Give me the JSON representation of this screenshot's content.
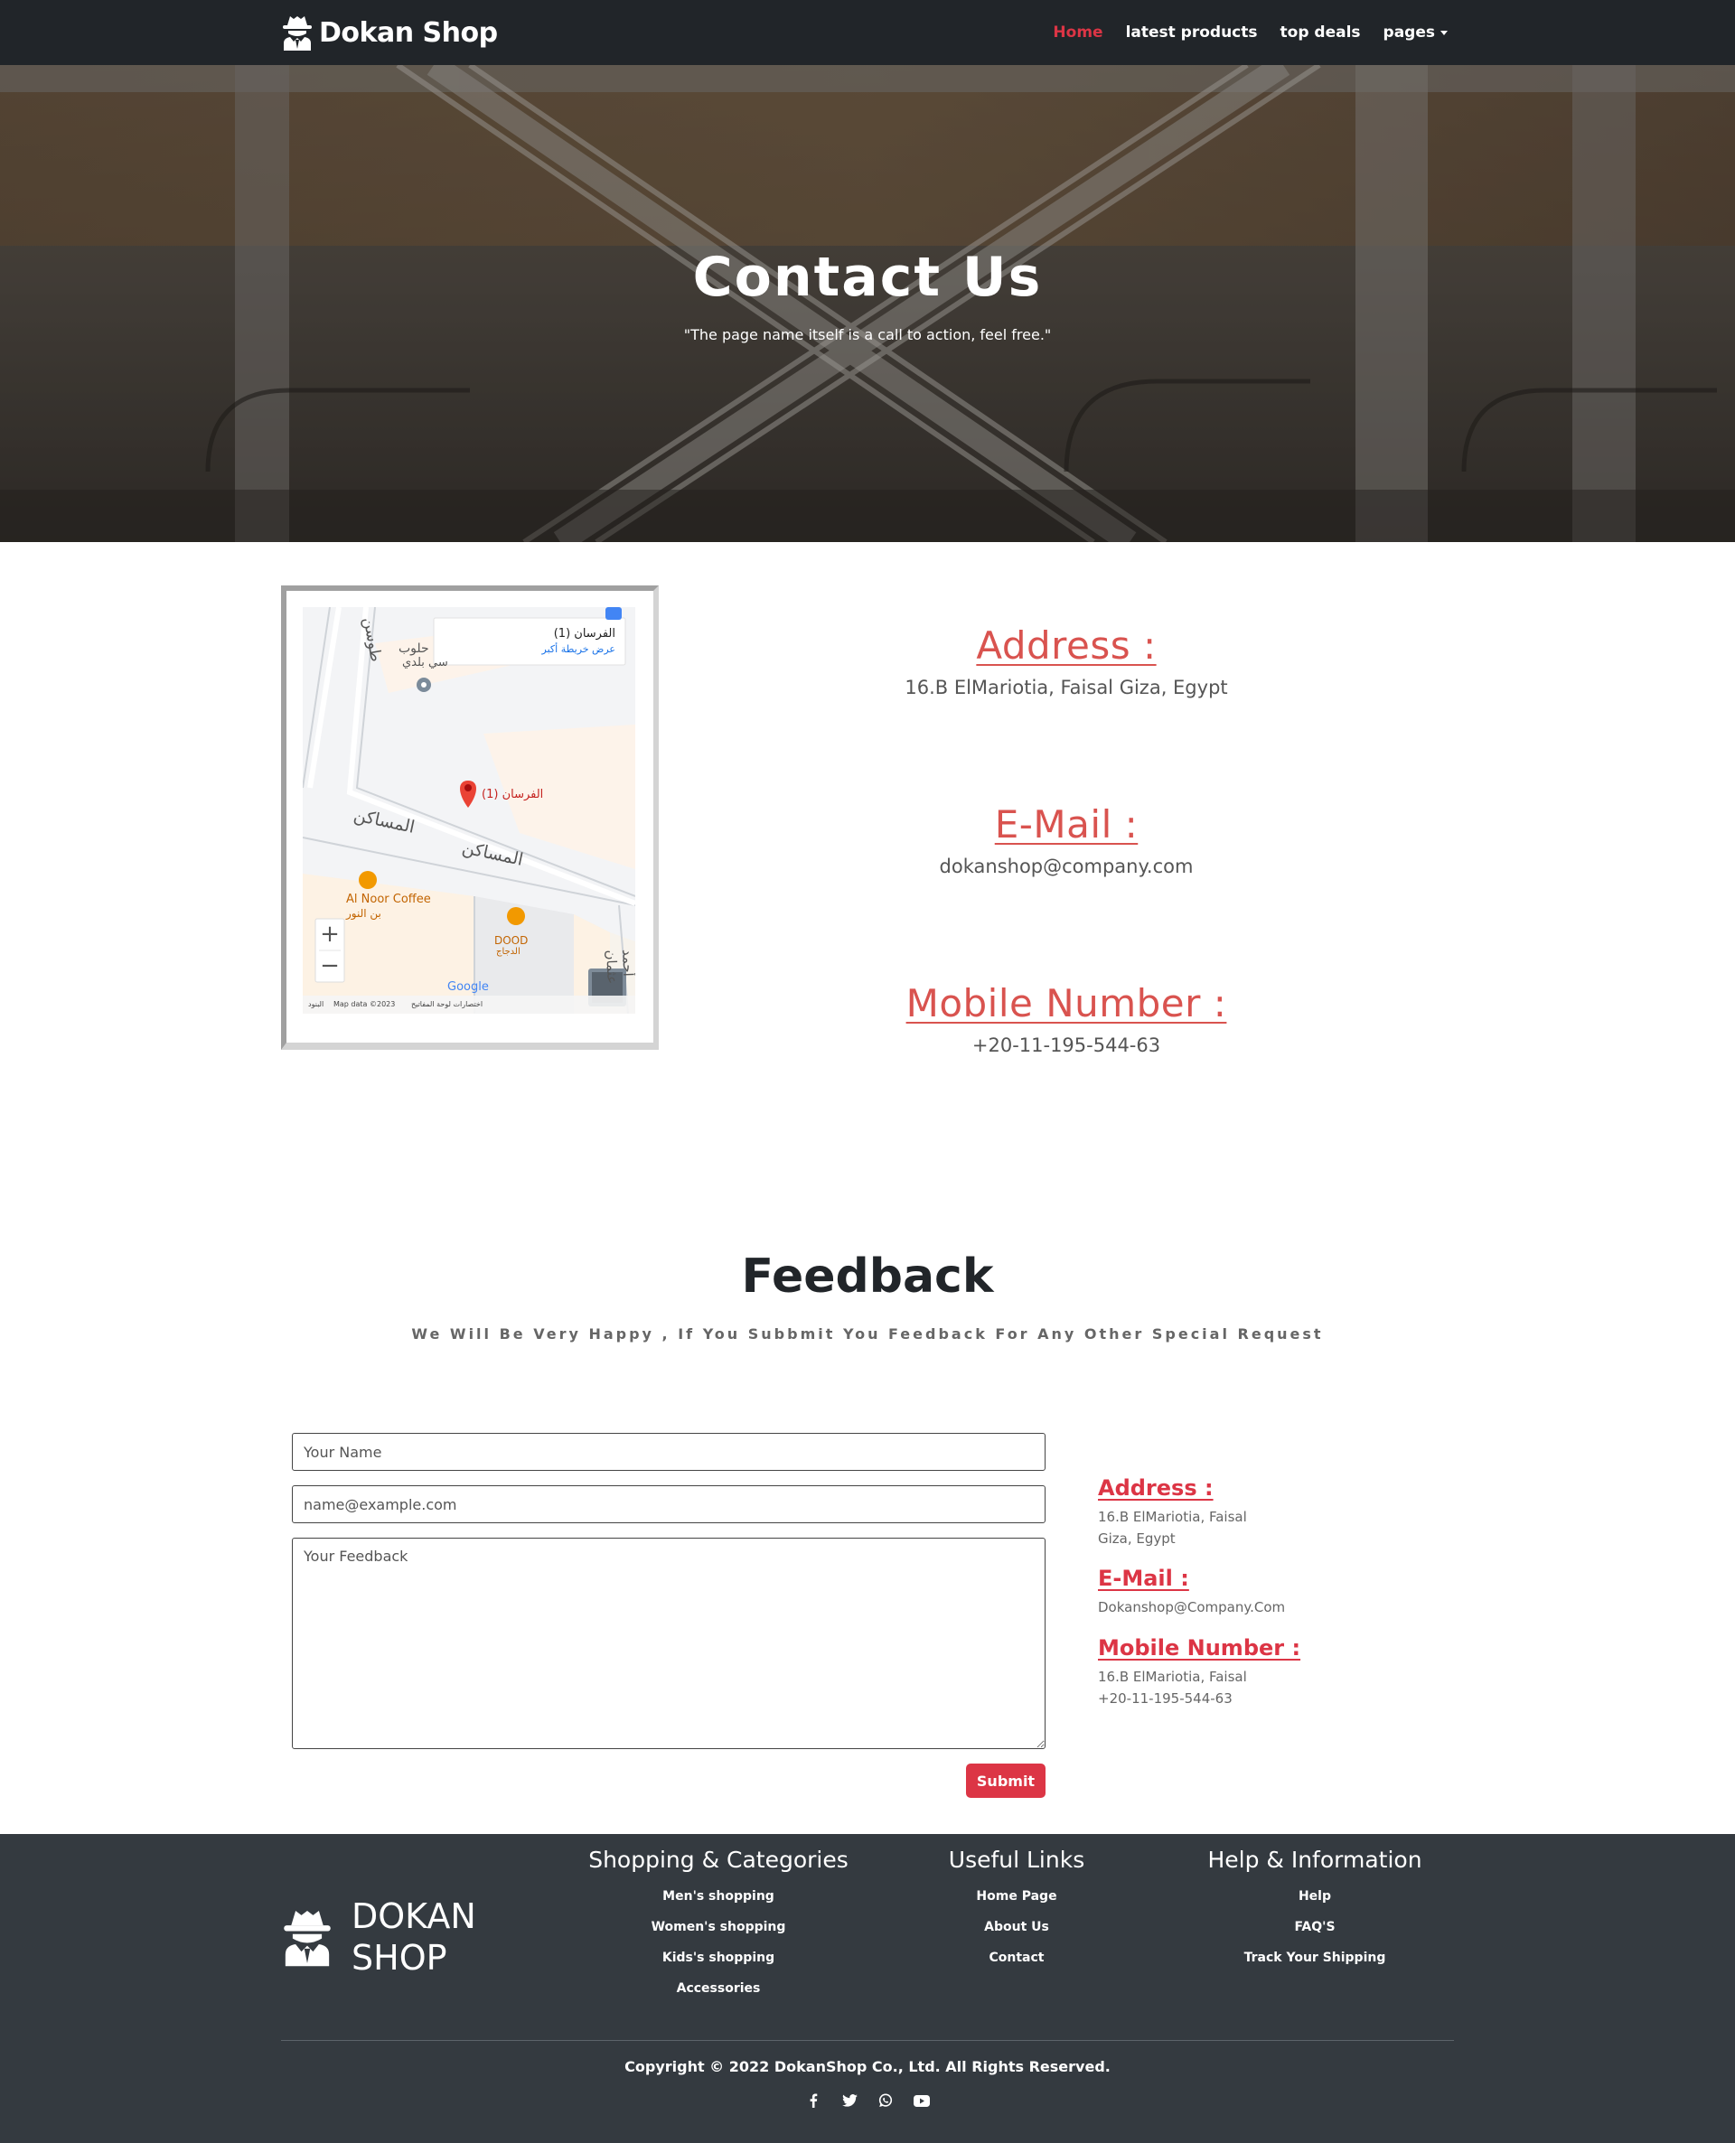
{
  "nav": {
    "brand": "Dokan Shop",
    "links": [
      "Home",
      "latest products",
      "top deals",
      "pages"
    ]
  },
  "hero": {
    "title": "Contact Us",
    "subtitle": "\"The page name itself is a call to action, feel free.\""
  },
  "map": {
    "place_name": "الفرسان (1)",
    "view_larger": "عرض خريطة أكبر",
    "labels": [
      "المساكن",
      "المساكن",
      "Al Noor Coffee",
      "بن النور",
      "DOOD",
      "الدجاج",
      "حلوب",
      "سي بلدي",
      "طوسن",
      "أحمد عثمان"
    ],
    "pin_label": "الفرسان (1)",
    "zoom_in": "+",
    "zoom_out": "−",
    "google": "Google",
    "map_data": "Map data ©2023",
    "shortcuts": "اختصارات لوحة المفاتيح",
    "terms": "البنود"
  },
  "contact": {
    "address_title": "Address :",
    "address": "16.B ElMariotia, Faisal Giza, Egypt",
    "email_title": "E-Mail :",
    "email": "dokanshop@company.com",
    "mobile_title": "Mobile Number :",
    "mobile": "+20-11-195-544-63"
  },
  "feedback": {
    "title": "Feedback",
    "subtitle": "We Will Be Very Happy , If You Subbmit You Feedback For Any Other Special Request",
    "name_placeholder": "Your Name",
    "email_placeholder": "name@example.com",
    "feedback_placeholder": "Your Feedback",
    "submit": "Submit"
  },
  "side_info": {
    "address_title": "Address :",
    "address_line1": "16.B ElMariotia, Faisal",
    "address_line2": "Giza, Egypt",
    "email_title": "E-Mail :",
    "email": "Dokanshop@Company.Com",
    "mobile_title": "Mobile Number :",
    "mobile_line1": "16.B ElMariotia, Faisal",
    "mobile_line2": "+20-11-195-544-63"
  },
  "footer": {
    "logo_line1": "DOKAN",
    "logo_line2": "SHOP",
    "col1_title": "Shopping & Categories",
    "col1_links": [
      "Men's shopping",
      "Women's shopping",
      "Kids's shopping",
      "Accessories"
    ],
    "col2_title": "Useful Links",
    "col2_links": [
      "Home Page",
      "About Us",
      "Contact"
    ],
    "col3_title": "Help & Information",
    "col3_links": [
      "Help",
      "FAQ'S",
      "Track Your Shipping"
    ],
    "copyright": "Copyright © 2022 DokanShop Co., Ltd. All Rights Reserved.",
    "socials": [
      "facebook-icon",
      "twitter-icon",
      "whatsapp-icon",
      "youtube-icon"
    ]
  },
  "colors": {
    "accent": "#dc3545",
    "contact_title": "#d9534f",
    "navbar": "#212529",
    "footer": "#343a40"
  }
}
